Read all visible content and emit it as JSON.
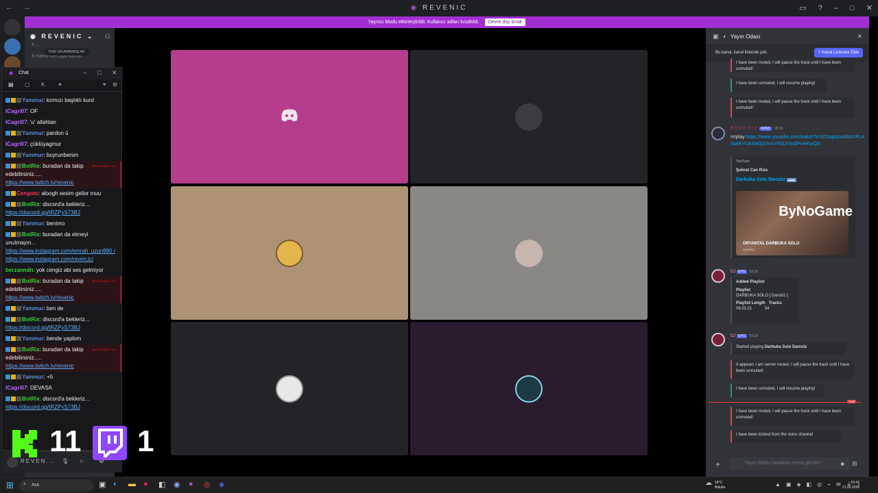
{
  "window": {
    "title": "REVENIC",
    "nav": "← →"
  },
  "banner": {
    "text": "Yayıncı Modu etkinleştirildi. Kullanıcı adları kısaltıldı.",
    "button": "Devre dışı bırak"
  },
  "server": {
    "name": "REVENIC",
    "channels": [
      "# ...",
      "# mame-ve-caps-kanalı"
    ],
    "unread_pill": "YENİ OKUNMAMIŞLAR"
  },
  "chat": {
    "title": "Chat",
    "lines": [
      {
        "type": "msg",
        "user": "Yammur",
        "color": "u-blue",
        "badges": 3,
        "text": "kırmızı başlıklı kurd"
      },
      {
        "type": "msg",
        "user": "ICagri07",
        "color": "u-purple",
        "badges": 0,
        "text": "OF"
      },
      {
        "type": "msg",
        "user": "ICagri07",
        "color": "u-purple",
        "badges": 0,
        "text": "'u' allahtan"
      },
      {
        "type": "msg",
        "user": "Yammur",
        "color": "u-blue",
        "badges": 3,
        "text": "pardon ü"
      },
      {
        "type": "msg",
        "user": "ICagri07",
        "color": "u-purple",
        "badges": 0,
        "text": "çüklüyagmur"
      },
      {
        "type": "msg",
        "user": "Yammur",
        "color": "u-blue",
        "badges": 3,
        "text": "buyrunbenim"
      },
      {
        "type": "mention",
        "user": "BotRix",
        "color": "u-green",
        "badges": 3,
        "text": "buradan da takip edebilirsiniz.....",
        "link": "https://www.twitch.tv/revenic",
        "tag": "MENTIONING YOU"
      },
      {
        "type": "msg",
        "user": "Cengotv",
        "color": "u-red",
        "badges": 2,
        "text": "aloogh sesim gelior muu"
      },
      {
        "type": "msg",
        "user": "BotRix",
        "color": "u-green",
        "badges": 3,
        "text": "discord'a bekleriz...",
        "link": "https://discord.gg/tRZPyS73BJ"
      },
      {
        "type": "msg",
        "user": "Yammur",
        "color": "u-blue",
        "badges": 3,
        "text": "benimo"
      },
      {
        "type": "msg",
        "user": "BotRix",
        "color": "u-green",
        "badges": 3,
        "text": "buradan da etmeyi unutmayın...",
        "link": "https://www.instagram.com/emrah_uzun990 / https://www.instagram.com/reven.lc/"
      },
      {
        "type": "msg",
        "user": "berzanndn",
        "color": "u-green",
        "badges": 0,
        "text": "yok cengiz abi ses gelmiyor"
      },
      {
        "type": "mention",
        "user": "BotRix",
        "color": "u-green",
        "badges": 3,
        "text": "buradan da takip edebilirsiniz.....",
        "link": "https://www.twitch.tv/revenic",
        "tag": "MENTIONING YOU"
      },
      {
        "type": "msg",
        "user": "Yammur",
        "color": "u-blue",
        "badges": 3,
        "text": "ben de"
      },
      {
        "type": "msg",
        "user": "BotRix",
        "color": "u-green",
        "badges": 3,
        "text": "discord'a bekleriz...",
        "link": "https://discord.gg/tRZPyS73BJ"
      },
      {
        "type": "msg",
        "user": "Yammur",
        "color": "u-blue",
        "badges": 3,
        "text": "bende yaplom"
      },
      {
        "type": "mention",
        "user": "BotRix",
        "color": "u-green",
        "badges": 3,
        "text": "buradan da takip edebilirsiniz.....",
        "link": "https://www.twitch.tv/revenic",
        "tag": "MENTIONING YOU"
      },
      {
        "type": "msg",
        "user": "Yammur",
        "color": "u-blue",
        "badges": 3,
        "text": "+5"
      },
      {
        "type": "msg",
        "user": "ICagri07",
        "color": "u-purple",
        "badges": 0,
        "text": "DEVASA"
      },
      {
        "type": "msg",
        "user": "BotRix",
        "color": "u-green",
        "badges": 3,
        "text": "discord'a bekleriz...",
        "link": "https://discord.gg/tRZPyS73BJ"
      }
    ]
  },
  "overlay": {
    "kick_count": "11",
    "twitch_count": "1"
  },
  "userbar": {
    "name": "REVEN..."
  },
  "right_panel": {
    "title": "Yayın Odası",
    "notice": "Bu kanal, kanal listende yok.",
    "add_button": "+ Kanal Listesine Ekle",
    "embeds_top": [
      {
        "text": "I have been muted, I will pause the track until I have been unmuted!",
        "color": "red"
      },
      {
        "text": "I have been unmuted, I will resume playing!",
        "color": "green"
      },
      {
        "text": "I have been muted, I will pause the track until I have been unmuted!",
        "color": "red"
      }
    ],
    "msg1": {
      "name": "REVENIC",
      "badge": "RVNC",
      "time": "03:16",
      "text": "m!play",
      "link": "https://www.youtube.com/watch?v=b10aptAiw&list=PLA5wkEYUkSW2jz0mcYf05JYhs5FoHKwQX",
      "embed_source": "YouTube",
      "embed_author": "Şuhrat Can Rıza",
      "embed_title": "Darbuka Solo Dansöz",
      "thumb_caption": "ORYANTAL DARBUKA SOLO",
      "thumb_sub": "DANSÖZ",
      "watermark": "ByNoGame"
    },
    "msg2": {
      "name": "DJ",
      "badge": "UYG",
      "time": "03:16",
      "added": "Added Playlist",
      "playlist_label": "Playlist",
      "playlist_name": "DARBUKA SOLO [ Dansöz ]",
      "length_label": "Playlist Length",
      "length_value": "06:01:21",
      "tracks_label": "Tracks",
      "tracks_value": "54"
    },
    "msg3": {
      "name": "DJ",
      "badge": "UYG",
      "time": "03:16",
      "started": "Started playing",
      "track": "Darbuka Solo Dansöz",
      "e1": "It appears I am server muted, I will pause the track until I have been unmuted!",
      "e2": "I have been unmuted, I will resume playing!",
      "new_tag": "YENİ",
      "e3": "I have been muted, I will pause the track until I have been unmuted!",
      "e4": "I have been kicked from the voice channel"
    },
    "composer_placeholder": "Yayın Odası kanalına mesaj gönder"
  },
  "taskbar": {
    "search": "Ara",
    "weather_temp": "18°C",
    "weather_desc": "Bulutlu",
    "time": "03:42",
    "date": "21.02.2026"
  },
  "colors": {
    "accent": "#a12fd1",
    "tile_pink": "#b53d8c",
    "tile_tan": "#ae9275",
    "tile_grey": "#8a8885",
    "tile_dark": "#232428",
    "tile_purple": "#2a1b2e"
  }
}
